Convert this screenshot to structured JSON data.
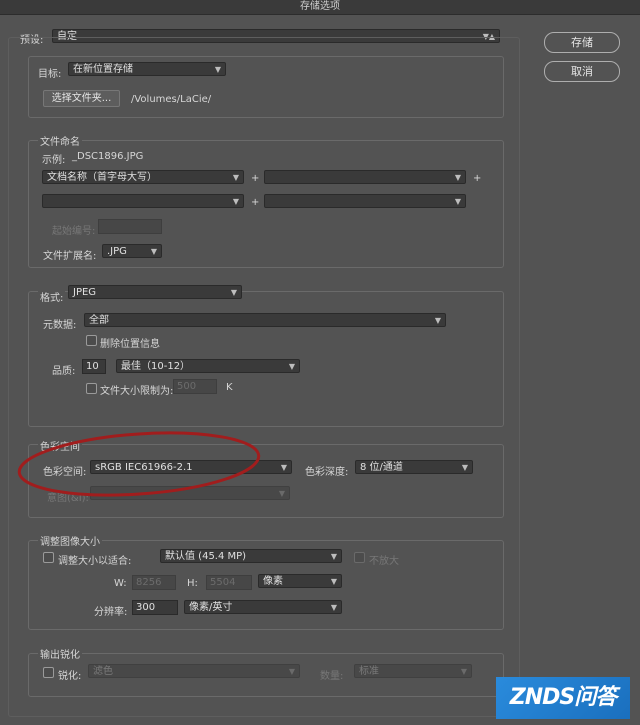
{
  "window": {
    "title": "存储选项"
  },
  "preset": {
    "label": "预设:",
    "value": "自定"
  },
  "buttons": {
    "save": "存储",
    "cancel": "取消"
  },
  "target": {
    "label": "目标:",
    "value": "在新位置存储",
    "choose_folder": "选择文件夹...",
    "path": "/Volumes/LaCie/"
  },
  "naming": {
    "title": "文件命名",
    "example_label": "示例:",
    "example_value": "_DSC1896.JPG",
    "field1": "文档名称（首字母大写）",
    "field2": "",
    "field3": "",
    "field4": "",
    "plus": "+",
    "start_number_label": "起始编号:",
    "start_number_value": "",
    "extension_label": "文件扩展名:",
    "extension_value": ".JPG"
  },
  "format": {
    "label": "格式:",
    "value": "JPEG",
    "metadata_label": "元数据:",
    "metadata_value": "全部",
    "remove_location_label": "删除位置信息",
    "remove_location_checked": false,
    "quality_label": "品质:",
    "quality_value": "10",
    "quality_preset": "最佳（10-12）",
    "limit_size_label": "文件大小限制为:",
    "limit_size_checked": false,
    "limit_size_value": "500",
    "limit_size_unit": "K"
  },
  "color_space": {
    "title": "色彩空间",
    "label": "色彩空间:",
    "value": "sRGB IEC61966-2.1",
    "depth_label": "色彩深度:",
    "depth_value": "8 位/通道",
    "intent_label": "意图(&I):",
    "intent_value": ""
  },
  "resize": {
    "title": "调整图像大小",
    "fit_label": "调整大小以适合:",
    "fit_checked": false,
    "fit_value": "默认值 (45.4 MP)",
    "no_enlarge_label": "不放大",
    "no_enlarge_checked": false,
    "w_label": "W:",
    "w_value": "8256",
    "h_label": "H:",
    "h_value": "5504",
    "unit": "像素",
    "resolution_label": "分辨率:",
    "resolution_value": "300",
    "resolution_unit": "像素/英寸"
  },
  "sharpen": {
    "title": "输出锐化",
    "label": "锐化:",
    "checked": false,
    "target_value": "滤色",
    "amount_label": "数量:",
    "amount_value": "标准"
  },
  "watermark": {
    "text": "ZNDS问答"
  },
  "colors": {
    "background": "#535353",
    "annotation": "#a11d1d",
    "watermark": "#2a8bdc"
  }
}
